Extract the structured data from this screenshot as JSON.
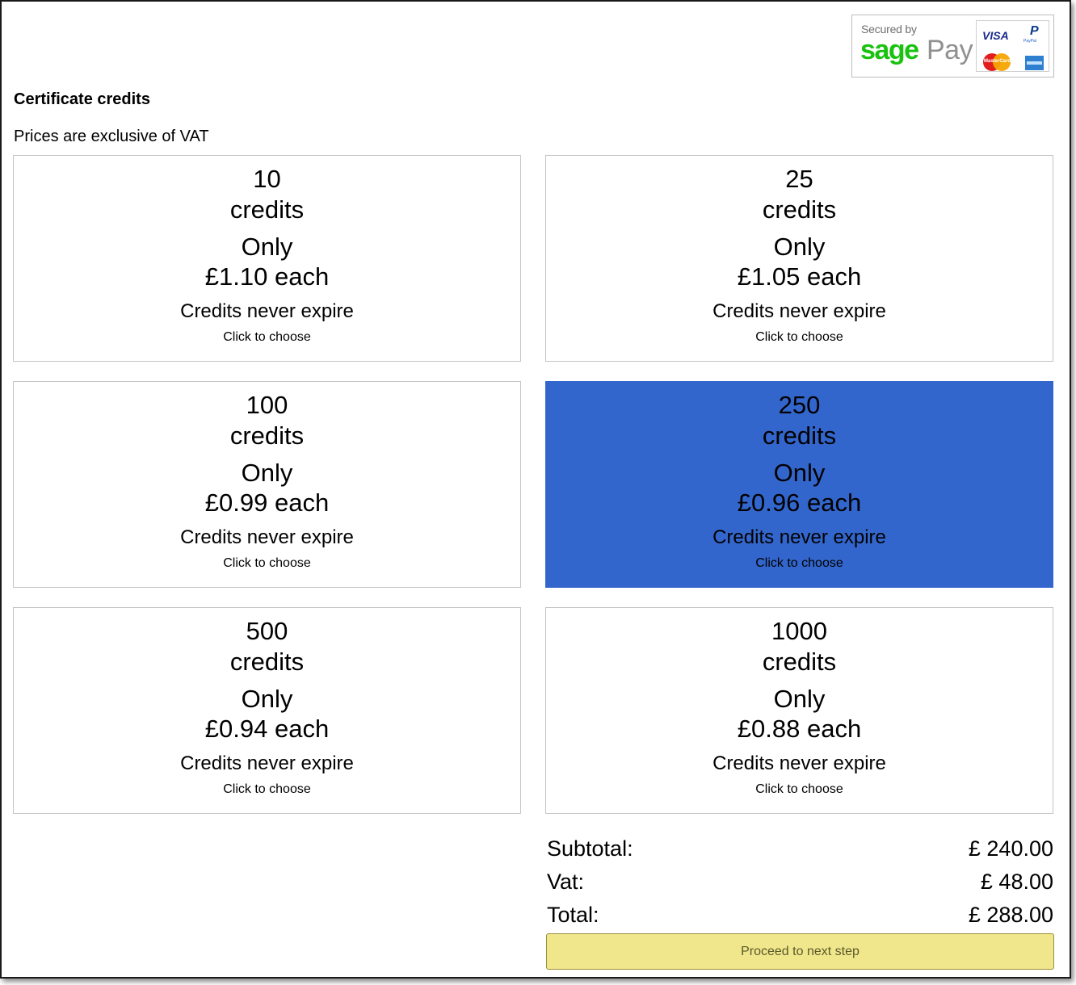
{
  "badge": {
    "secured_by": "Secured by",
    "brand_sage": "sage",
    "brand_pay": "Pay",
    "cards": [
      "VISA",
      "PayPal",
      "MasterCard",
      "American Express"
    ]
  },
  "header": {
    "title": "Certificate credits",
    "vat_note": "Prices are exclusive of VAT"
  },
  "packages": [
    {
      "qty": "10",
      "unit": "credits",
      "only": "Only",
      "price": "£1.10 each",
      "expire": "Credits never expire",
      "cta": "Click to choose",
      "selected": false
    },
    {
      "qty": "25",
      "unit": "credits",
      "only": "Only",
      "price": "£1.05 each",
      "expire": "Credits never expire",
      "cta": "Click to choose",
      "selected": false
    },
    {
      "qty": "100",
      "unit": "credits",
      "only": "Only",
      "price": "£0.99 each",
      "expire": "Credits never expire",
      "cta": "Click to choose",
      "selected": false
    },
    {
      "qty": "250",
      "unit": "credits",
      "only": "Only",
      "price": "£0.96 each",
      "expire": "Credits never expire",
      "cta": "Click to choose",
      "selected": true
    },
    {
      "qty": "500",
      "unit": "credits",
      "only": "Only",
      "price": "£0.94 each",
      "expire": "Credits never expire",
      "cta": "Click to choose",
      "selected": false
    },
    {
      "qty": "1000",
      "unit": "credits",
      "only": "Only",
      "price": "£0.88 each",
      "expire": "Credits never expire",
      "cta": "Click to choose",
      "selected": false
    }
  ],
  "summary": {
    "subtotal_label": "Subtotal:",
    "subtotal_value": "£ 240.00",
    "vat_label": "Vat:",
    "vat_value": "£ 48.00",
    "total_label": "Total:",
    "total_value": "£ 288.00"
  },
  "actions": {
    "proceed_label": "Proceed to next step"
  },
  "colors": {
    "selected_tile": "#3366cc",
    "proceed_button": "#f0e68c",
    "sage_green": "#19c20f"
  }
}
